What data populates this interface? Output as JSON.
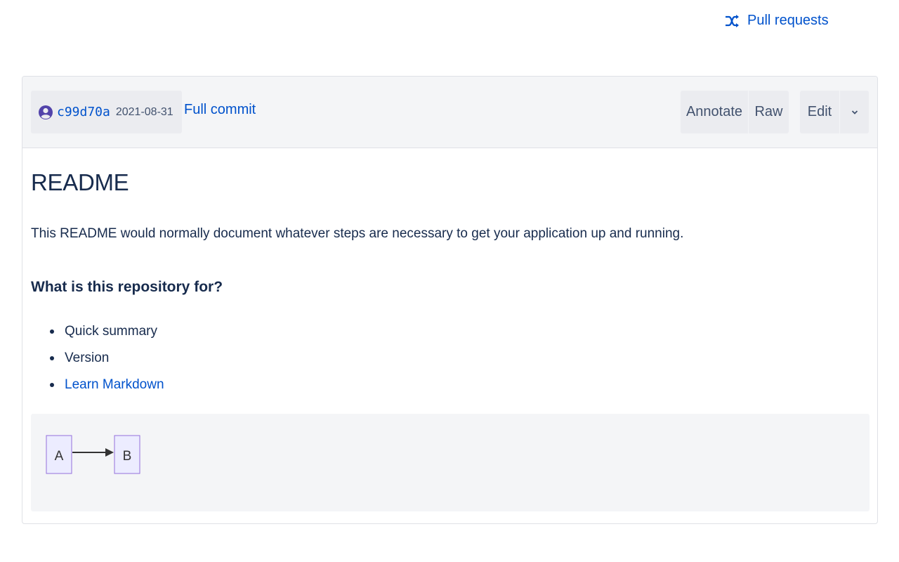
{
  "top_nav": {
    "pull_requests_label": "Pull requests",
    "pull_requests_icon": "pull-request-icon"
  },
  "commit_bar": {
    "avatar_icon": "user-avatar-icon",
    "hash": "c99d70a",
    "date": "2021-08-31",
    "full_commit_label": "Full commit"
  },
  "actions": {
    "annotate_label": "Annotate",
    "raw_label": "Raw",
    "edit_label": "Edit",
    "more_icon": "chevron-down-icon"
  },
  "readme": {
    "title": "README",
    "intro": "This README would normally document whatever steps are necessary to get your application up and running.",
    "section_heading": "What is this repository for?",
    "items": [
      {
        "label": "Quick summary",
        "is_link": false
      },
      {
        "label": "Version",
        "is_link": false
      },
      {
        "label": "Learn Markdown",
        "is_link": true
      }
    ]
  },
  "diagram": {
    "nodes": [
      "A",
      "B"
    ],
    "edge": "A to B"
  },
  "colors": {
    "link": "#0052cc",
    "text": "#172b4d",
    "header_bg": "#f4f5f7",
    "node_fill": "#ececff",
    "node_stroke": "#9370db"
  }
}
